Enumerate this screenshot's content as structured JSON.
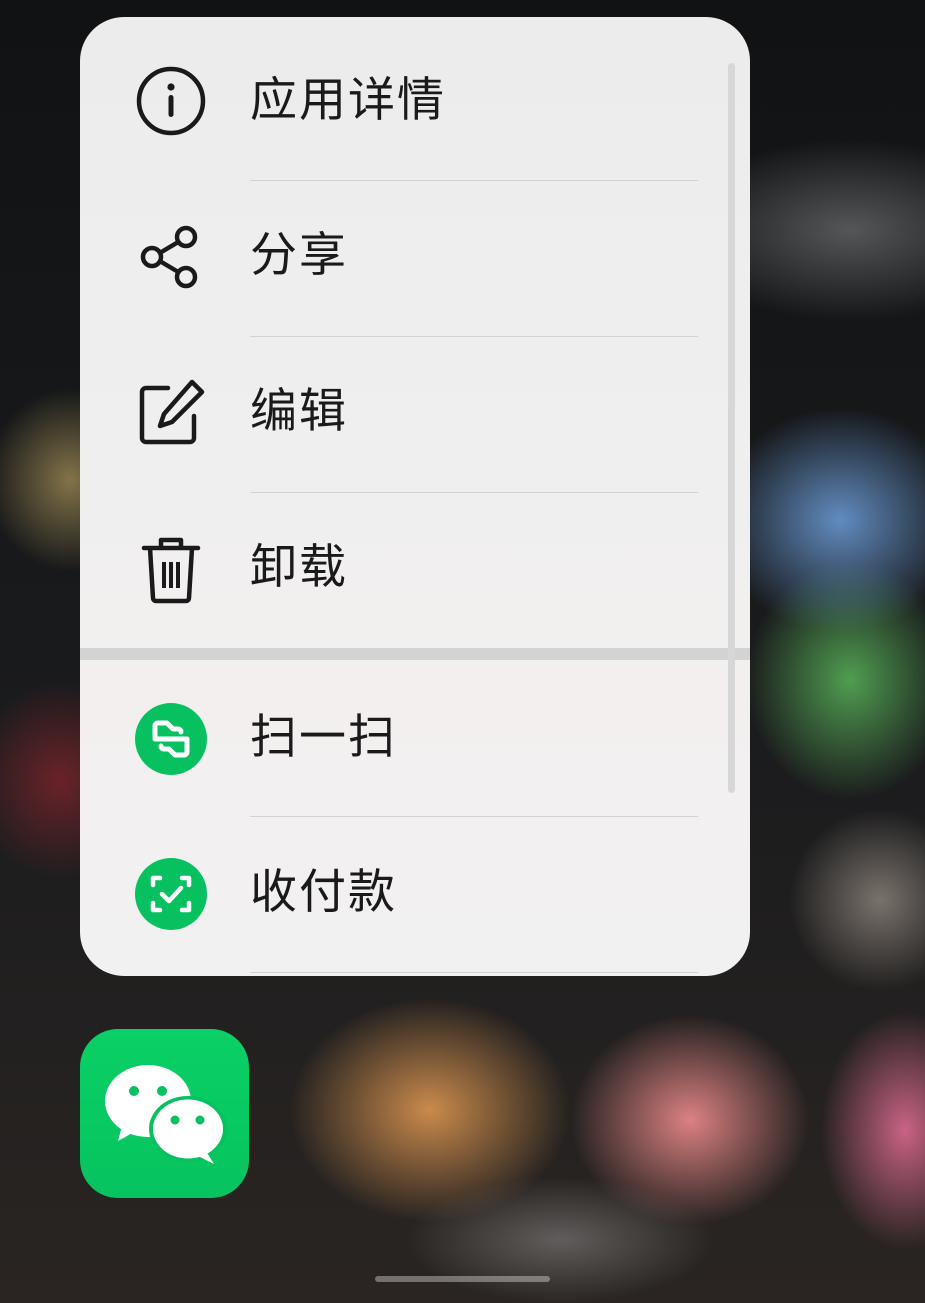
{
  "context_menu": {
    "system_items": [
      {
        "label": "应用详情",
        "icon": "info-icon"
      },
      {
        "label": "分享",
        "icon": "share-icon"
      },
      {
        "label": "编辑",
        "icon": "edit-icon"
      },
      {
        "label": "卸载",
        "icon": "trash-icon"
      }
    ],
    "app_shortcuts": [
      {
        "label": "扫一扫",
        "icon": "scan-icon"
      },
      {
        "label": "收付款",
        "icon": "payment-icon"
      }
    ]
  },
  "app": {
    "icon": "wechat-icon"
  },
  "colors": {
    "menu_background": "#efefef",
    "shortcut_green": "#07c160",
    "text": "#1a1a1a"
  }
}
